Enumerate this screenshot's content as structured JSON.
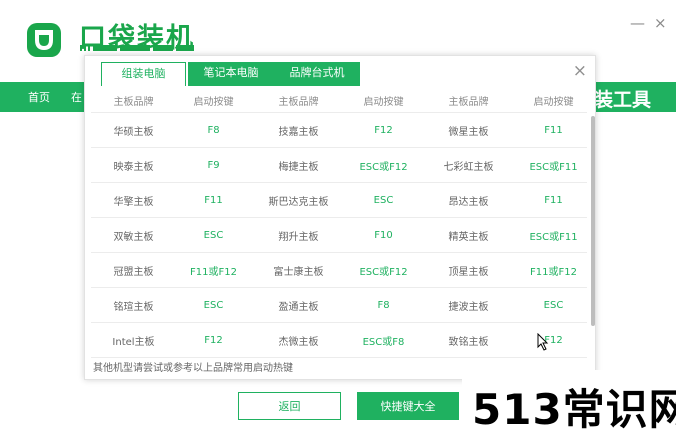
{
  "app": {
    "title": "口袋装机",
    "subtitle_glyphs": "IIIIII  WWWWW  WWW",
    "minimize": "—",
    "close": "×"
  },
  "nav": {
    "items": [
      "首页",
      "在"
    ],
    "big_label": "装工具"
  },
  "modal": {
    "tabs": [
      {
        "label": "组装电脑",
        "active": true
      },
      {
        "label": "笔记本电脑",
        "active": false
      },
      {
        "label": "品牌台式机",
        "active": false
      }
    ],
    "close": "×",
    "headers": [
      "主板品牌",
      "启动按键",
      "主板品牌",
      "启动按键",
      "主板品牌",
      "启动按键"
    ],
    "rows": [
      [
        "华硕主板",
        "F8",
        "技嘉主板",
        "F12",
        "微星主板",
        "F11"
      ],
      [
        "映泰主板",
        "F9",
        "梅捷主板",
        "ESC或F12",
        "七彩虹主板",
        "ESC或F11"
      ],
      [
        "华擎主板",
        "F11",
        "斯巴达克主板",
        "ESC",
        "昂达主板",
        "F11"
      ],
      [
        "双敏主板",
        "ESC",
        "翔升主板",
        "F10",
        "精英主板",
        "ESC或F11"
      ],
      [
        "冠盟主板",
        "F11或F12",
        "富士康主板",
        "ESC或F12",
        "顶星主板",
        "F11或F12"
      ],
      [
        "铭瑄主板",
        "ESC",
        "盈通主板",
        "F8",
        "捷波主板",
        "ESC"
      ],
      [
        "Intel主板",
        "F12",
        "杰微主板",
        "ESC或F8",
        "致铭主板",
        "F12"
      ]
    ],
    "footnote": "其他机型请尝试或参考以上品牌常用启动热键"
  },
  "buttons": {
    "back": "返回",
    "shortcuts": "快捷键大全"
  },
  "watermark": "513常识网",
  "colors": {
    "accent": "#1fb160",
    "brand_green": "#1aa64b"
  }
}
